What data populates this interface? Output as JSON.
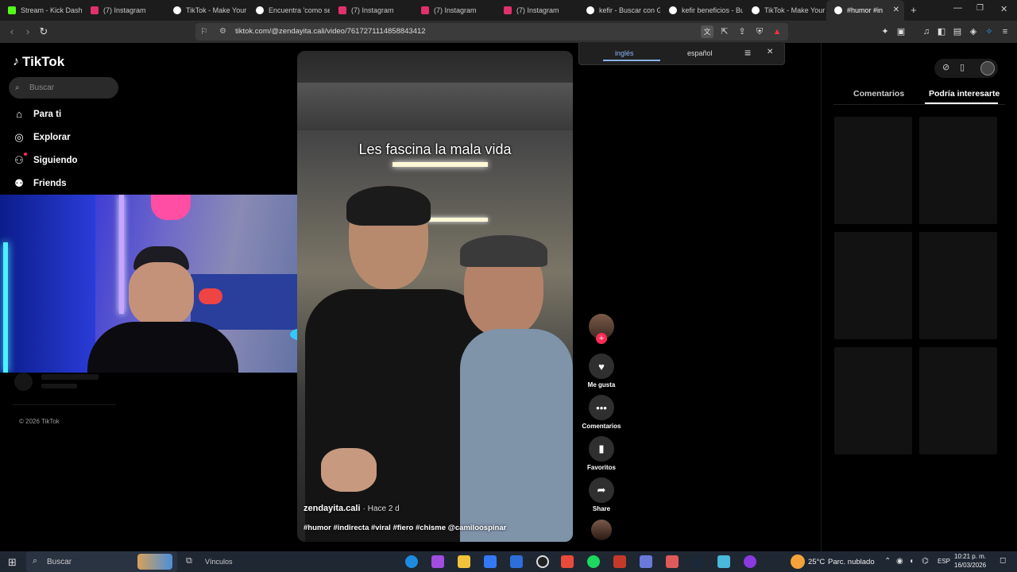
{
  "browser": {
    "tabs": [
      {
        "label": "Stream - Kick Dashb",
        "color": "#53fc18"
      },
      {
        "label": "(7) Instagram",
        "color": "#e1306c"
      },
      {
        "label": "TikTok - Make Your",
        "color": "#ffffff"
      },
      {
        "label": "Encuentra 'como se",
        "color": "#ffffff"
      },
      {
        "label": "(7) Instagram",
        "color": "#e1306c"
      },
      {
        "label": "(7) Instagram",
        "color": "#e1306c"
      },
      {
        "label": "(7) Instagram",
        "color": "#e1306c"
      },
      {
        "label": "kefir - Buscar con G",
        "color": "#ffffff"
      },
      {
        "label": "kefir beneficios - Bu",
        "color": "#ffffff"
      },
      {
        "label": "TikTok - Make Your",
        "color": "#ffffff"
      },
      {
        "label": "#humor #in",
        "color": "#ffffff",
        "active": true
      }
    ],
    "url": "tiktok.com/@zendayita.cali/video/7617271114858843412",
    "translate": {
      "lang1": "inglés",
      "lang2": "español"
    }
  },
  "sidebar": {
    "logo": "TikTok",
    "search_placeholder": "Buscar",
    "nav": [
      {
        "label": "Para ti",
        "icon": "home-icon"
      },
      {
        "label": "Explorar",
        "icon": "compass-icon"
      },
      {
        "label": "Siguiendo",
        "icon": "following-icon"
      },
      {
        "label": "Friends",
        "icon": "friends-icon"
      }
    ],
    "footer": "© 2026 TikTok"
  },
  "video": {
    "caption": "Les fascina la mala vida",
    "author": "zendayita.cali",
    "time": "· Hace 2 d",
    "hashtags": "#humor #indirecta #viral #fiero #chisme @camiloospinar"
  },
  "actions": {
    "like": "Me gusta",
    "comments": "Comentarios",
    "favorites": "Favoritos",
    "share": "Share"
  },
  "right_panel": {
    "tab_comments": "Comentarios",
    "tab_interest": "Podría interesarte"
  },
  "taskbar": {
    "search": "Buscar",
    "links": "Vínculos",
    "weather": "25°C",
    "weather_desc": "Parc. nublado",
    "lang": "ESP",
    "time": "10:21 p. m.",
    "date": "16/03/2026"
  }
}
